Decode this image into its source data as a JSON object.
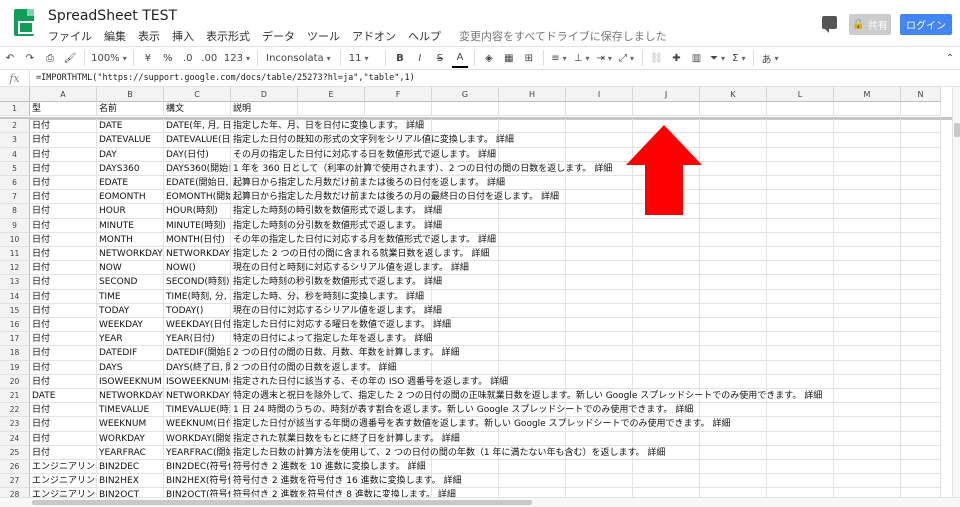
{
  "app": {
    "title": "SpreadSheet TEST",
    "save_status": "変更内容をすべてドライブに保存しました",
    "share_label": "共有",
    "login_label": "ログイン"
  },
  "menu": [
    "ファイル",
    "編集",
    "表示",
    "挿入",
    "表示形式",
    "データ",
    "ツール",
    "アドオン",
    "ヘルプ"
  ],
  "toolbar": {
    "zoom": "100%",
    "currency": "¥",
    "percent": "%",
    "dec_decrease": ".0",
    "dec_increase": ".00",
    "more_formats": "123",
    "font": "Inconsolata",
    "font_size": "11",
    "bold": "B",
    "italic": "I",
    "strike": "S",
    "text_color": "A",
    "functions": "Σ",
    "input_tools": "あ"
  },
  "formula_bar": {
    "fx": "fx",
    "formula": "=IMPORTHTML(\"https://support.google.com/docs/table/25273?hl=ja\",\"table\",1)"
  },
  "columns": [
    "A",
    "B",
    "C",
    "D",
    "E",
    "F",
    "G",
    "H",
    "I",
    "J",
    "K",
    "L",
    "M",
    "N"
  ],
  "rows": [
    {
      "n": "1",
      "a": "型",
      "b": "名前",
      "c": "構文",
      "d": "説明"
    },
    {
      "n": "2",
      "a": "日付",
      "b": "DATE",
      "c": "DATE(年, 月, 日)",
      "d": "指定した年、月、日を日付に変換します。 詳細"
    },
    {
      "n": "3",
      "a": "日付",
      "b": "DATEVALUE",
      "c": "DATEVALUE(日付",
      "d": "指定した日付の既知の形式の文字列をシリアル値に変換します。 詳細"
    },
    {
      "n": "4",
      "a": "日付",
      "b": "DAY",
      "c": "DAY(日付)",
      "d": "その月の指定した日付に対応する日を数値形式で返します。 詳細"
    },
    {
      "n": "5",
      "a": "日付",
      "b": "DAYS360",
      "c": "DAYS360(開始日",
      "d": "1 年を 360 日として（利率の計算で使用されます）、2 つの日付の間の日数を返します。 詳細"
    },
    {
      "n": "6",
      "a": "日付",
      "b": "EDATE",
      "c": "EDATE(開始日, 月",
      "d": "起算日から指定した月数だけ前または後ろの日付を返します。 詳細"
    },
    {
      "n": "7",
      "a": "日付",
      "b": "EOMONTH",
      "c": "EOMONTH(開始",
      "d": "起算日から指定した月数だけ前または後ろの月の最終日の日付を返します。 詳細"
    },
    {
      "n": "8",
      "a": "日付",
      "b": "HOUR",
      "c": "HOUR(時刻)",
      "d": "指定した時刻の時引数を数値形式で返します。 詳細"
    },
    {
      "n": "9",
      "a": "日付",
      "b": "MINUTE",
      "c": "MINUTE(時刻)",
      "d": "指定した時刻の分引数を数値形式で返します。 詳細"
    },
    {
      "n": "10",
      "a": "日付",
      "b": "MONTH",
      "c": "MONTH(日付)",
      "d": "その年の指定した日付に対応する月を数値形式で返します。 詳細"
    },
    {
      "n": "11",
      "a": "日付",
      "b": "NETWORKDAYS",
      "c": "NETWORKDAYS",
      "d": "指定した 2 つの日付の間に含まれる就業日数を返します。 詳細"
    },
    {
      "n": "12",
      "a": "日付",
      "b": "NOW",
      "c": "NOW()",
      "d": "現在の日付と時刻に対応するシリアル値を返します。 詳細"
    },
    {
      "n": "13",
      "a": "日付",
      "b": "SECOND",
      "c": "SECOND(時刻)",
      "d": "指定した時刻の秒引数を数値形式で返します。 詳細"
    },
    {
      "n": "14",
      "a": "日付",
      "b": "TIME",
      "c": "TIME(時刻, 分, 秒",
      "d": "指定した時、分、秒を時刻に変換します。 詳細"
    },
    {
      "n": "15",
      "a": "日付",
      "b": "TODAY",
      "c": "TODAY()",
      "d": "現在の日付に対応するシリアル値を返します。 詳細"
    },
    {
      "n": "16",
      "a": "日付",
      "b": "WEEKDAY",
      "c": "WEEKDAY(日付,",
      "d": "指定した日付に対応する曜日を数値で返します。 詳細"
    },
    {
      "n": "17",
      "a": "日付",
      "b": "YEAR",
      "c": "YEAR(日付)",
      "d": "特定の日付によって指定した年を返します。 詳細"
    },
    {
      "n": "18",
      "a": "日付",
      "b": "DATEDIF",
      "c": "DATEDIF(開始日",
      "d": "2 つの日付の間の日数、月数、年数を計算します。 詳細"
    },
    {
      "n": "19",
      "a": "日付",
      "b": "DAYS",
      "c": "DAYS(終了日, 開",
      "d": "2 つの日付の間の日数を返します。 詳細"
    },
    {
      "n": "20",
      "a": "日付",
      "b": "ISOWEEKNUM",
      "c": "ISOWEEKNUM(",
      "d": "指定された日付に該当する、その年の ISO 週番号を返します。 詳細"
    },
    {
      "n": "21",
      "a": "DATE",
      "b": "NETWORKDAYS",
      "c": "NETWORKDAYS",
      "d": "特定の週末と祝日を除外して、指定した 2 つの日付の間の正味就業日数を返します。新しい Google スプレッドシートでのみ使用できます。 詳細"
    },
    {
      "n": "22",
      "a": "日付",
      "b": "TIMEVALUE",
      "c": "TIMEVALUE(時刻",
      "d": "1 日 24 時間のうちの、時刻が表す割合を返します。新しい Google スプレッドシートでのみ使用できます。 詳細"
    },
    {
      "n": "23",
      "a": "日付",
      "b": "WEEKNUM",
      "c": "WEEKNUM(日付",
      "d": "指定した日付が該当する年間の週番号を表す数値を返します。新しい Google スプレッドシートでのみ使用できます。 詳細"
    },
    {
      "n": "24",
      "a": "日付",
      "b": "WORKDAY",
      "c": "WORKDAY(開始",
      "d": "指定された就業日数をもとに終了日を計算します。 詳細"
    },
    {
      "n": "25",
      "a": "日付",
      "b": "YEARFRAC",
      "c": "YEARFRAC(開始",
      "d": "指定した日数の計算方法を使用して、2 つの日付の間の年数（1 年に満たない年も含む）を返します。 詳細"
    },
    {
      "n": "26",
      "a": "エンジニアリング",
      "b": "BIN2DEC",
      "c": "BIN2DEC(符号付",
      "d": "符号付き 2 進数を 10 進数に変換します。 詳細"
    },
    {
      "n": "27",
      "a": "エンジニアリング",
      "b": "BIN2HEX",
      "c": "BIN2HEX(符号付",
      "d": "符号付き 2 進数を符号付き 16 進数に変換します。 詳細"
    },
    {
      "n": "28",
      "a": "エンジニアリング",
      "b": "BIN2OCT",
      "c": "BIN2OCT(符号付",
      "d": "符号付き 2 進数を符号付き 8 進数に変換します。 詳細"
    }
  ],
  "colors": {
    "sheets_green": "#0f9d58",
    "login_blue": "#4285f4",
    "arrow_red": "#ff0000"
  }
}
